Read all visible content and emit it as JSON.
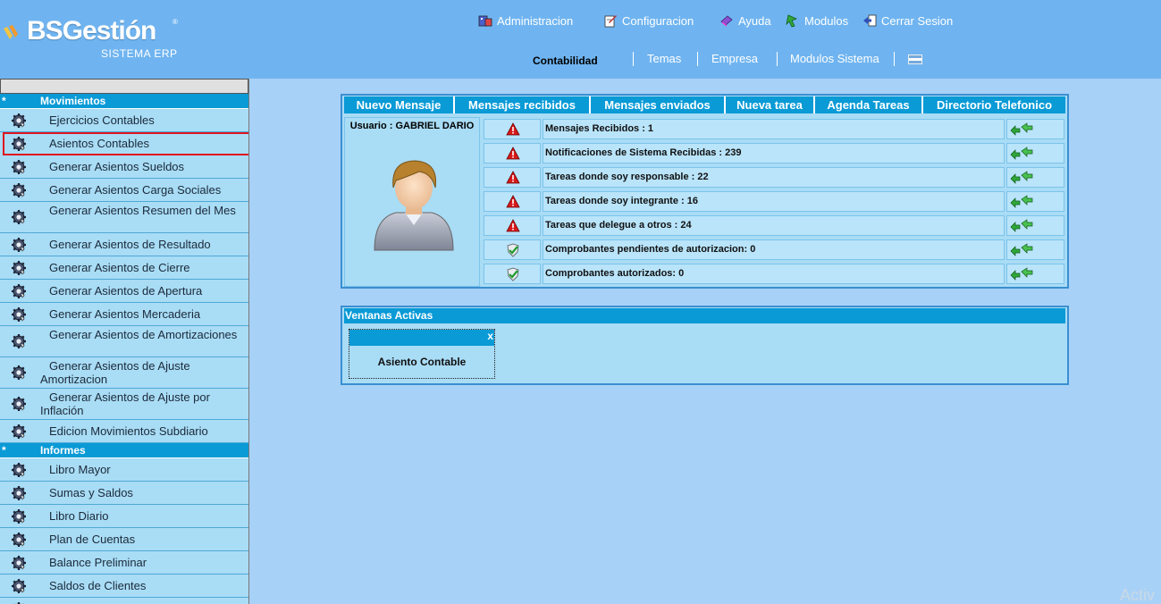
{
  "logo": {
    "brand": "BSGestión",
    "reg": "®",
    "subtitle": "SISTEMA ERP"
  },
  "top_menu": [
    {
      "label": "Administracion",
      "icon": "admin-icon"
    },
    {
      "label": "Configuracion",
      "icon": "config-icon"
    },
    {
      "label": "Ayuda",
      "icon": "help-icon"
    },
    {
      "label": "Modulos",
      "icon": "modules-icon"
    },
    {
      "label": "Cerrar Sesion",
      "icon": "logout-icon"
    }
  ],
  "sub_menu": {
    "active": "Contabilidad",
    "items": [
      "Temas",
      "Empresa",
      "Modulos Sistema"
    ],
    "flag": "argentina-flag-icon"
  },
  "sidebar": {
    "sections": [
      {
        "star": "*",
        "title": "Movimientos",
        "items": [
          "Ejercicios Contables",
          "Asientos Contables",
          "Generar Asientos Sueldos",
          "Generar Asientos Carga Sociales",
          "Generar Asientos Resumen del Mes",
          "Generar Asientos de Resultado",
          "Generar Asientos de Cierre",
          "Generar Asientos de Apertura",
          "Generar Asientos Mercaderia",
          "Generar Asientos de Amortizaciones",
          "Generar Asientos de Ajuste Amortizacion",
          "Generar Asientos de Ajuste por Inflación",
          "Edicion Movimientos Subdiario"
        ]
      },
      {
        "star": "*",
        "title": "Informes",
        "items": [
          "Libro Mayor",
          "Sumas y Saldos",
          "Libro Diario",
          "Plan de Cuentas",
          "Balance Preliminar",
          "Saldos de Clientes"
        ]
      }
    ]
  },
  "tabs": [
    "Nuevo Mensaje",
    "Mensajes recibidos",
    "Mensajes enviados",
    "Nueva tarea",
    "Agenda Tareas",
    "Directorio Telefonico"
  ],
  "user": {
    "label": "Usuario : GABRIEL DARIO"
  },
  "notifications": [
    {
      "text": "Mensajes Recibidos : 1",
      "icon": "warning-icon"
    },
    {
      "text": "Notificaciones de Sistema Recibidas : 239",
      "icon": "warning-icon"
    },
    {
      "text": "Tareas donde soy responsable : 22",
      "icon": "warning-icon"
    },
    {
      "text": "Tareas donde soy integrante : 16",
      "icon": "warning-icon"
    },
    {
      "text": "Tareas que delegue a otros : 24",
      "icon": "warning-icon"
    },
    {
      "text": "Comprobantes pendientes de autorizacion: 0",
      "icon": "check-shield-icon"
    },
    {
      "text": "Comprobantes autorizados: 0",
      "icon": "check-shield-icon"
    }
  ],
  "active_windows": {
    "title": "Ventanas Activas",
    "windows": [
      {
        "title": "Asiento Contable",
        "close": "x"
      }
    ]
  },
  "watermark": "Activ",
  "colors": {
    "header": "#6fb4f0",
    "accent": "#0a9ad6",
    "background": "#a8d1f7",
    "sidebar": "#a9dcf5",
    "highlight": "#e0141e"
  }
}
